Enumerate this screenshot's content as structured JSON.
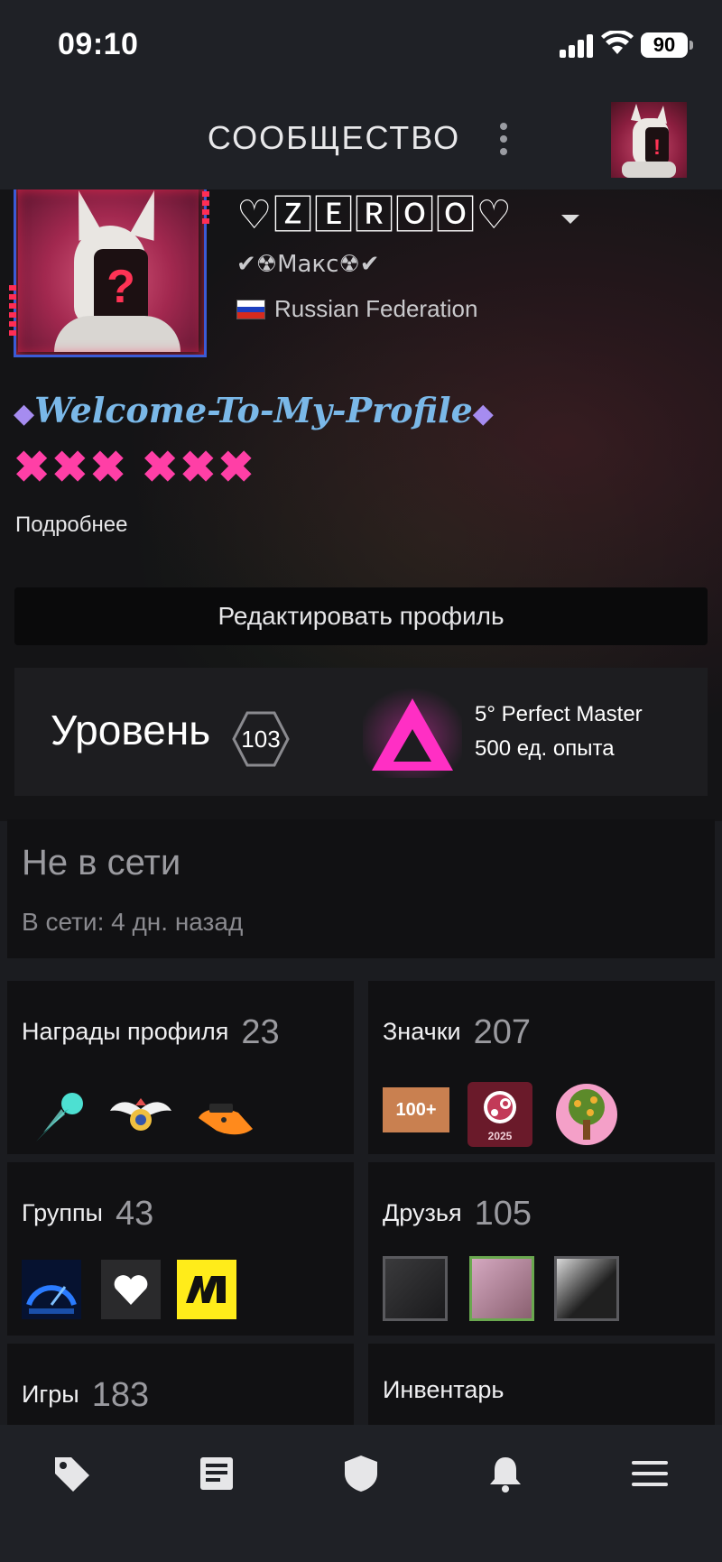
{
  "status_bar": {
    "time": "09:10",
    "battery": "90"
  },
  "header": {
    "title": "СООБЩЕСТВО"
  },
  "profile": {
    "persona_name": "♡🅉🄴🅁🄾🄾♡",
    "persona_name_plain": "♡ZEROO♡",
    "real_name": "✔☢Макс☢✔",
    "country": "Russian Federation",
    "summary_line1": "Welcome-To-My-Profile",
    "summary_diamond": "◆",
    "summary_line2": "✖✖✖ ✖✖✖",
    "more_link": "Подробнее",
    "edit_button": "Редактировать профиль"
  },
  "level": {
    "label": "Уровень",
    "value": "103",
    "badge_name": "5° Perfect Master",
    "badge_xp": "500 ед. опыта"
  },
  "online_status": {
    "status": "Не в сети",
    "last_online": "В сети: 4 дн. назад"
  },
  "cards": {
    "awards": {
      "title": "Награды профиля",
      "count": "23"
    },
    "badges": {
      "title": "Значки",
      "count": "207",
      "badge1_text": "100+",
      "badge2_text": "2025"
    },
    "groups": {
      "title": "Группы",
      "count": "43"
    },
    "friends": {
      "title": "Друзья",
      "count": "105"
    },
    "games": {
      "title": "Игры",
      "count": "183"
    },
    "inventory": {
      "title": "Инвентарь"
    }
  },
  "tab_bar": {
    "items": [
      "store-tag-icon",
      "news-icon",
      "shield-icon",
      "bell-icon",
      "menu-icon"
    ]
  },
  "colors": {
    "accent_pink": "#ff3fa6",
    "welcome_blue": "#7ab8e8",
    "background": "#1b1c20"
  }
}
